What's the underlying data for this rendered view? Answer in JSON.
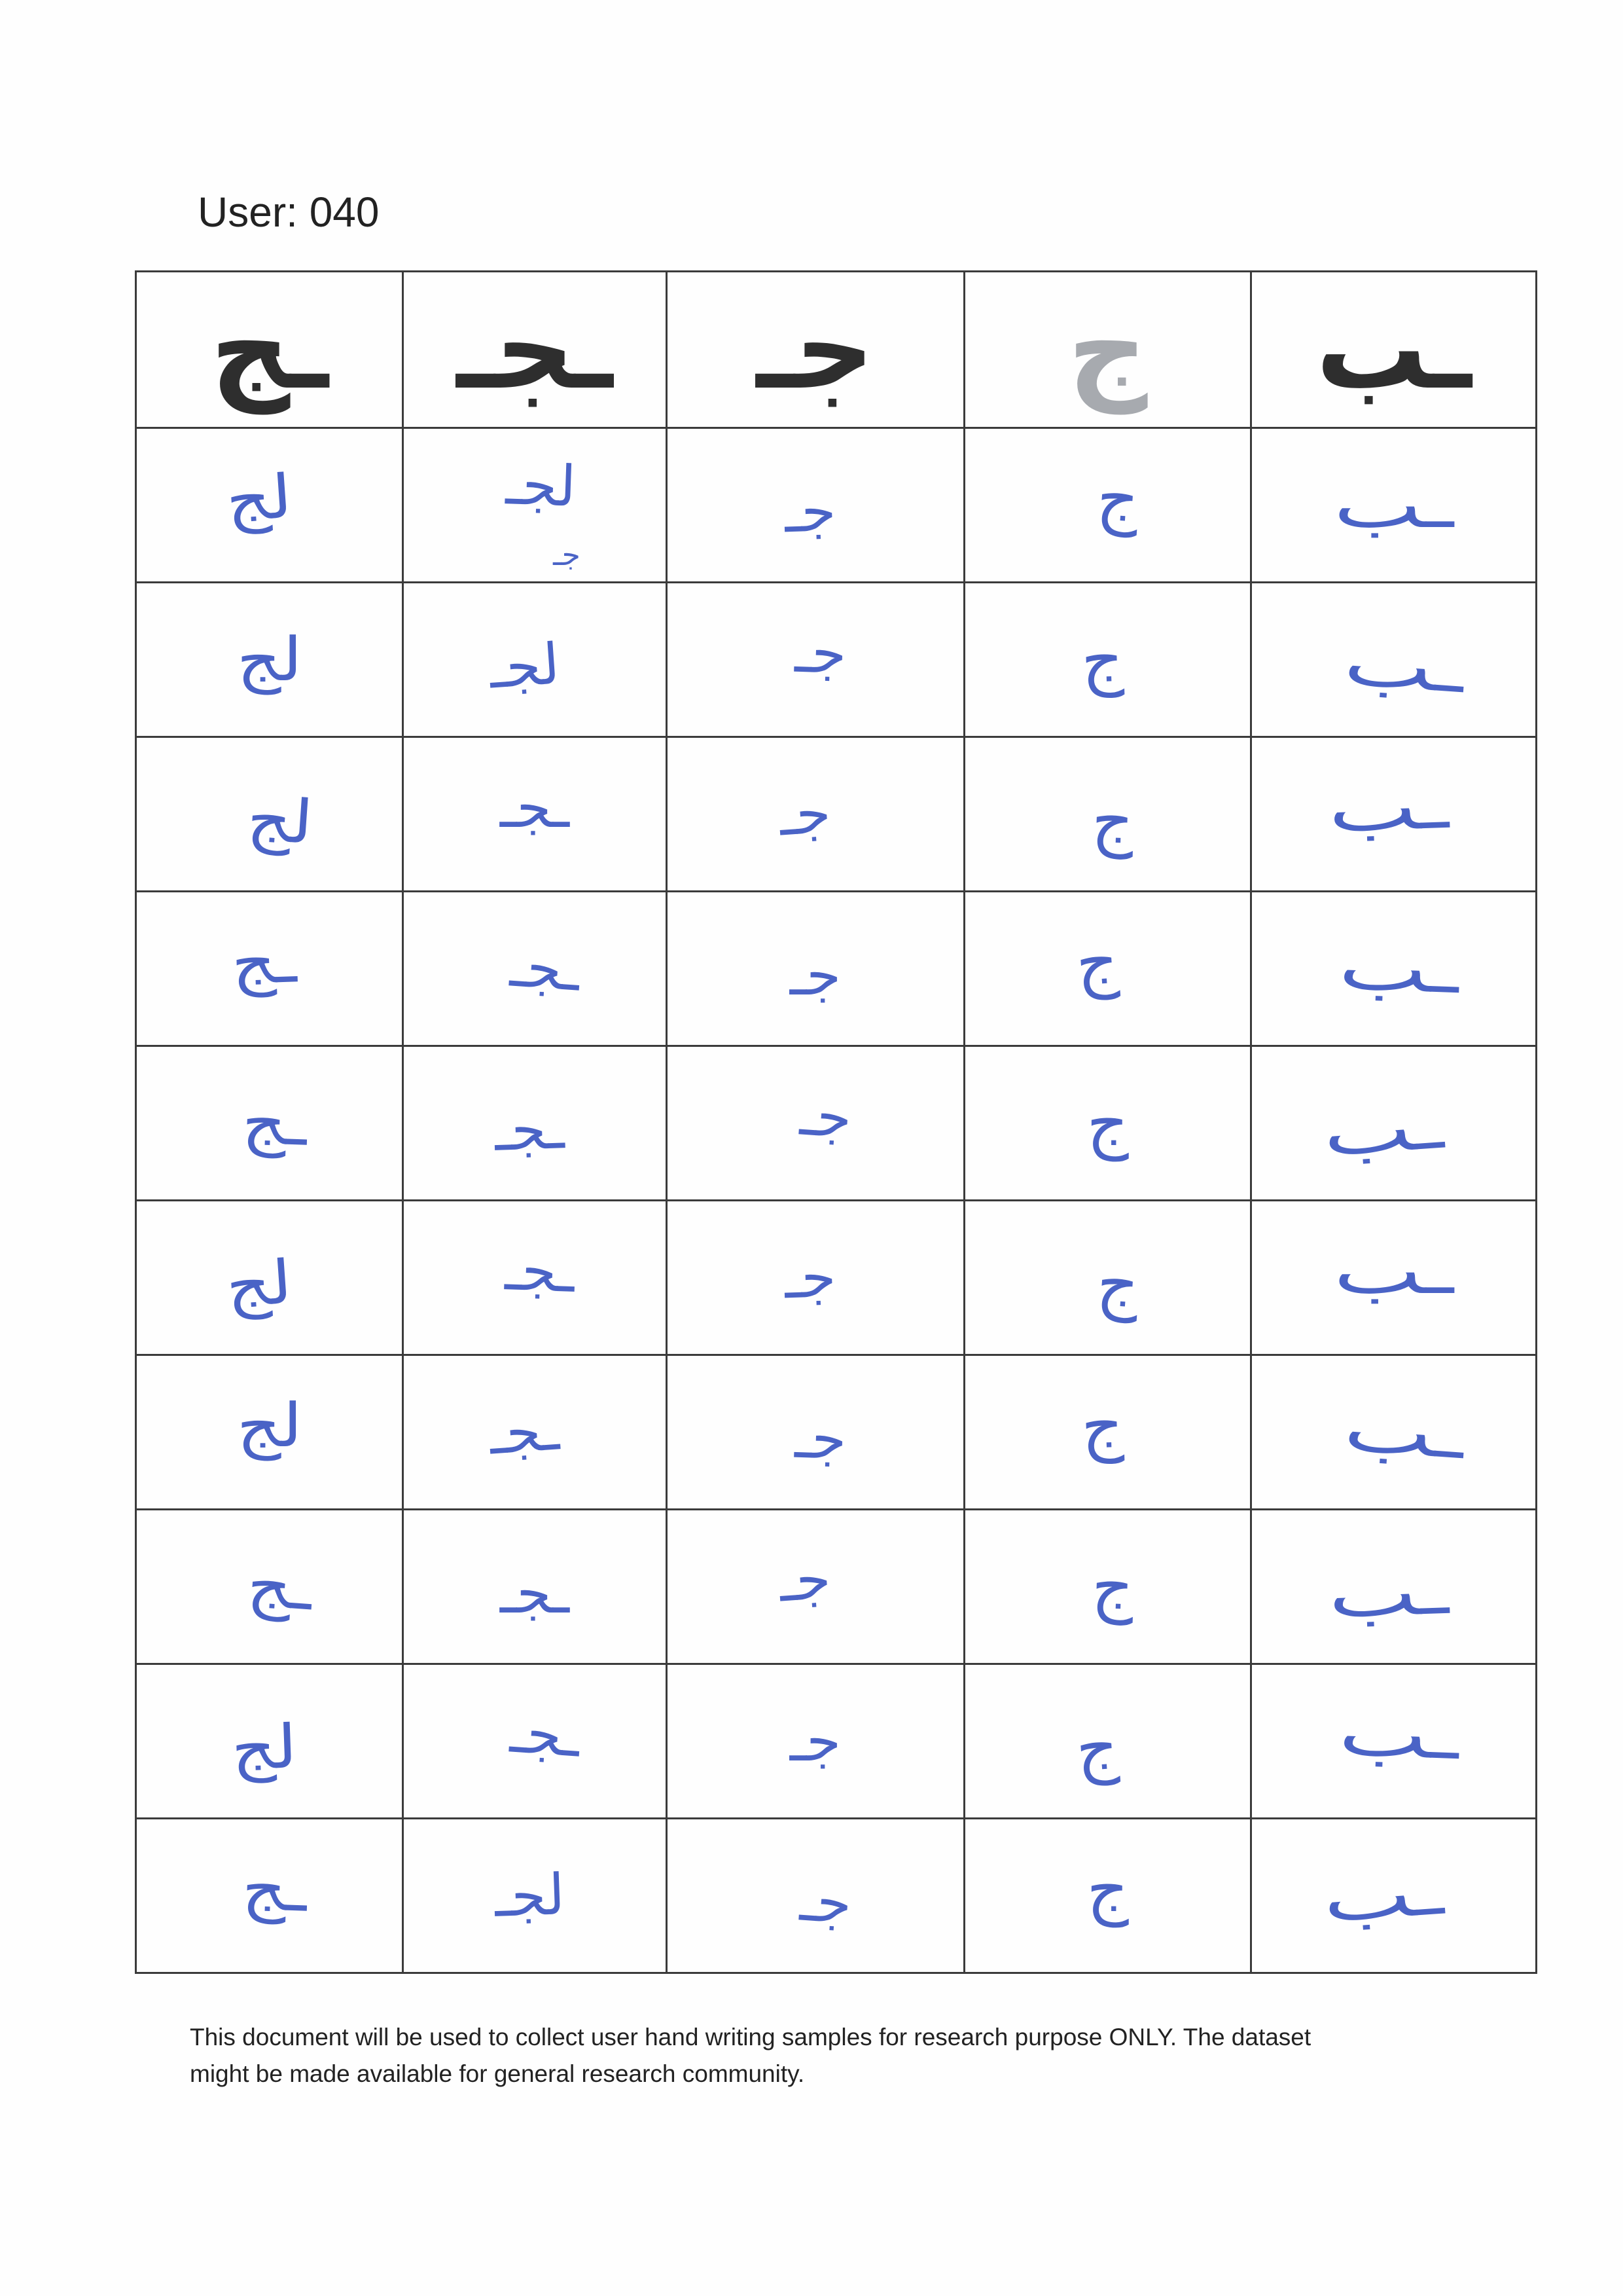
{
  "document": {
    "user_label": "User: 040"
  },
  "colors": {
    "ink": "#4a63c6",
    "print": "#2e2e2e",
    "print_light": "#a7aaaf",
    "grid": "#3b3b3b"
  },
  "header": [
    {
      "glyph": "ـج",
      "shade": "dark"
    },
    {
      "glyph": "ـجـ",
      "shade": "dark"
    },
    {
      "glyph": "جـ",
      "shade": "dark"
    },
    {
      "glyph": "ج",
      "shade": "light"
    },
    {
      "glyph": "ـب",
      "shade": "dark"
    }
  ],
  "samples": [
    [
      {
        "text": "لج"
      },
      {
        "text": "لجـ",
        "note": "جـ"
      },
      {
        "text": "جـ"
      },
      {
        "text": "ج"
      },
      {
        "text": "ـب"
      }
    ],
    [
      {
        "text": "لج"
      },
      {
        "text": "لجـ"
      },
      {
        "text": "جـ"
      },
      {
        "text": "ج"
      },
      {
        "text": "ـب"
      }
    ],
    [
      {
        "text": "لج"
      },
      {
        "text": "ـجـ"
      },
      {
        "text": "جـ"
      },
      {
        "text": "ج"
      },
      {
        "text": "ـب"
      }
    ],
    [
      {
        "text": "ـج"
      },
      {
        "text": "ـجـ"
      },
      {
        "text": "جـ"
      },
      {
        "text": "ج"
      },
      {
        "text": "ـب"
      }
    ],
    [
      {
        "text": "ـج"
      },
      {
        "text": "ـجـ"
      },
      {
        "text": "جـ"
      },
      {
        "text": "ج"
      },
      {
        "text": "ـب"
      }
    ],
    [
      {
        "text": "لج"
      },
      {
        "text": "ـجـ"
      },
      {
        "text": "جـ"
      },
      {
        "text": "ج"
      },
      {
        "text": "ـب"
      }
    ],
    [
      {
        "text": "لج"
      },
      {
        "text": "ـجـ"
      },
      {
        "text": "جـ"
      },
      {
        "text": "ج"
      },
      {
        "text": "ـب"
      }
    ],
    [
      {
        "text": "ـج"
      },
      {
        "text": "ـجـ"
      },
      {
        "text": "جـ"
      },
      {
        "text": "ج"
      },
      {
        "text": "ـب"
      }
    ],
    [
      {
        "text": "لج"
      },
      {
        "text": "ـجـ"
      },
      {
        "text": "جـ"
      },
      {
        "text": "ج"
      },
      {
        "text": "ـب"
      }
    ],
    [
      {
        "text": "ـج"
      },
      {
        "text": "لجـ"
      },
      {
        "text": "جـ"
      },
      {
        "text": "ج"
      },
      {
        "text": "ـب"
      }
    ]
  ],
  "footer": {
    "lines": [
      "This document will be used to collect user hand writing samples for research purpose ONLY. The dataset",
      "might be made available for general research community."
    ]
  }
}
